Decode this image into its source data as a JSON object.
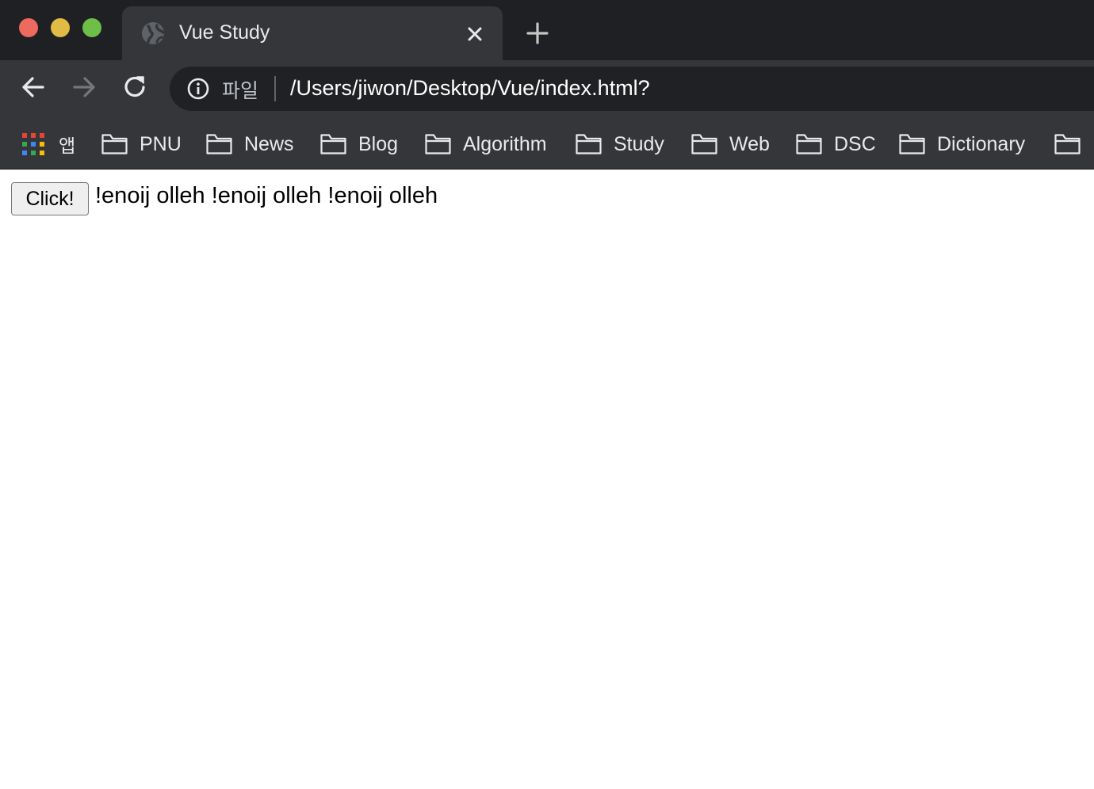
{
  "window": {
    "traffic_lights": [
      "close",
      "minimize",
      "maximize"
    ]
  },
  "tab": {
    "title": "Vue Study",
    "favicon": "globe-icon"
  },
  "toolbar": {
    "omnibox": {
      "scheme_label": "파일",
      "url": "/Users/jiwon/Desktop/Vue/index.html?"
    }
  },
  "bookmarks": {
    "apps_label": "앱",
    "items": [
      {
        "label": "PNU"
      },
      {
        "label": "News"
      },
      {
        "label": "Blog"
      },
      {
        "label": "Algorithm"
      },
      {
        "label": "Study"
      },
      {
        "label": "Web"
      },
      {
        "label": "DSC"
      },
      {
        "label": "Dictionary"
      }
    ]
  },
  "page": {
    "button_label": "Click!",
    "message": "!enoij olleh !enoij olleh !enoij olleh"
  },
  "colors": {
    "tabstrip_bg": "#1f2024",
    "toolbar_bg": "#35363a",
    "omnibox_bg": "#202124",
    "close": "#ed6a5e",
    "minimize": "#e0bb45",
    "maximize": "#6dbf47"
  }
}
